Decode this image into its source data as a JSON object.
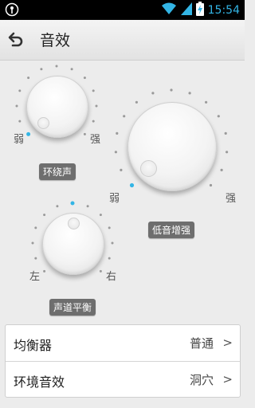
{
  "status": {
    "time": "15:54"
  },
  "header": {
    "title": "音效"
  },
  "surround": {
    "label": "环绕声",
    "min_label": "弱",
    "max_label": "强",
    "level": 0
  },
  "bass": {
    "label": "低音增强",
    "min_label": "弱",
    "max_label": "强",
    "level": 0
  },
  "balance": {
    "label": "声道平衡",
    "left_label": "左",
    "right_label": "右",
    "level": 0.5
  },
  "settings": {
    "equalizer": {
      "label": "均衡器",
      "value": "普通"
    },
    "environment": {
      "label": "环境音效",
      "value": "洞穴"
    }
  },
  "colors": {
    "accent": "#33b5e5",
    "pill": "#6e6e6e"
  }
}
